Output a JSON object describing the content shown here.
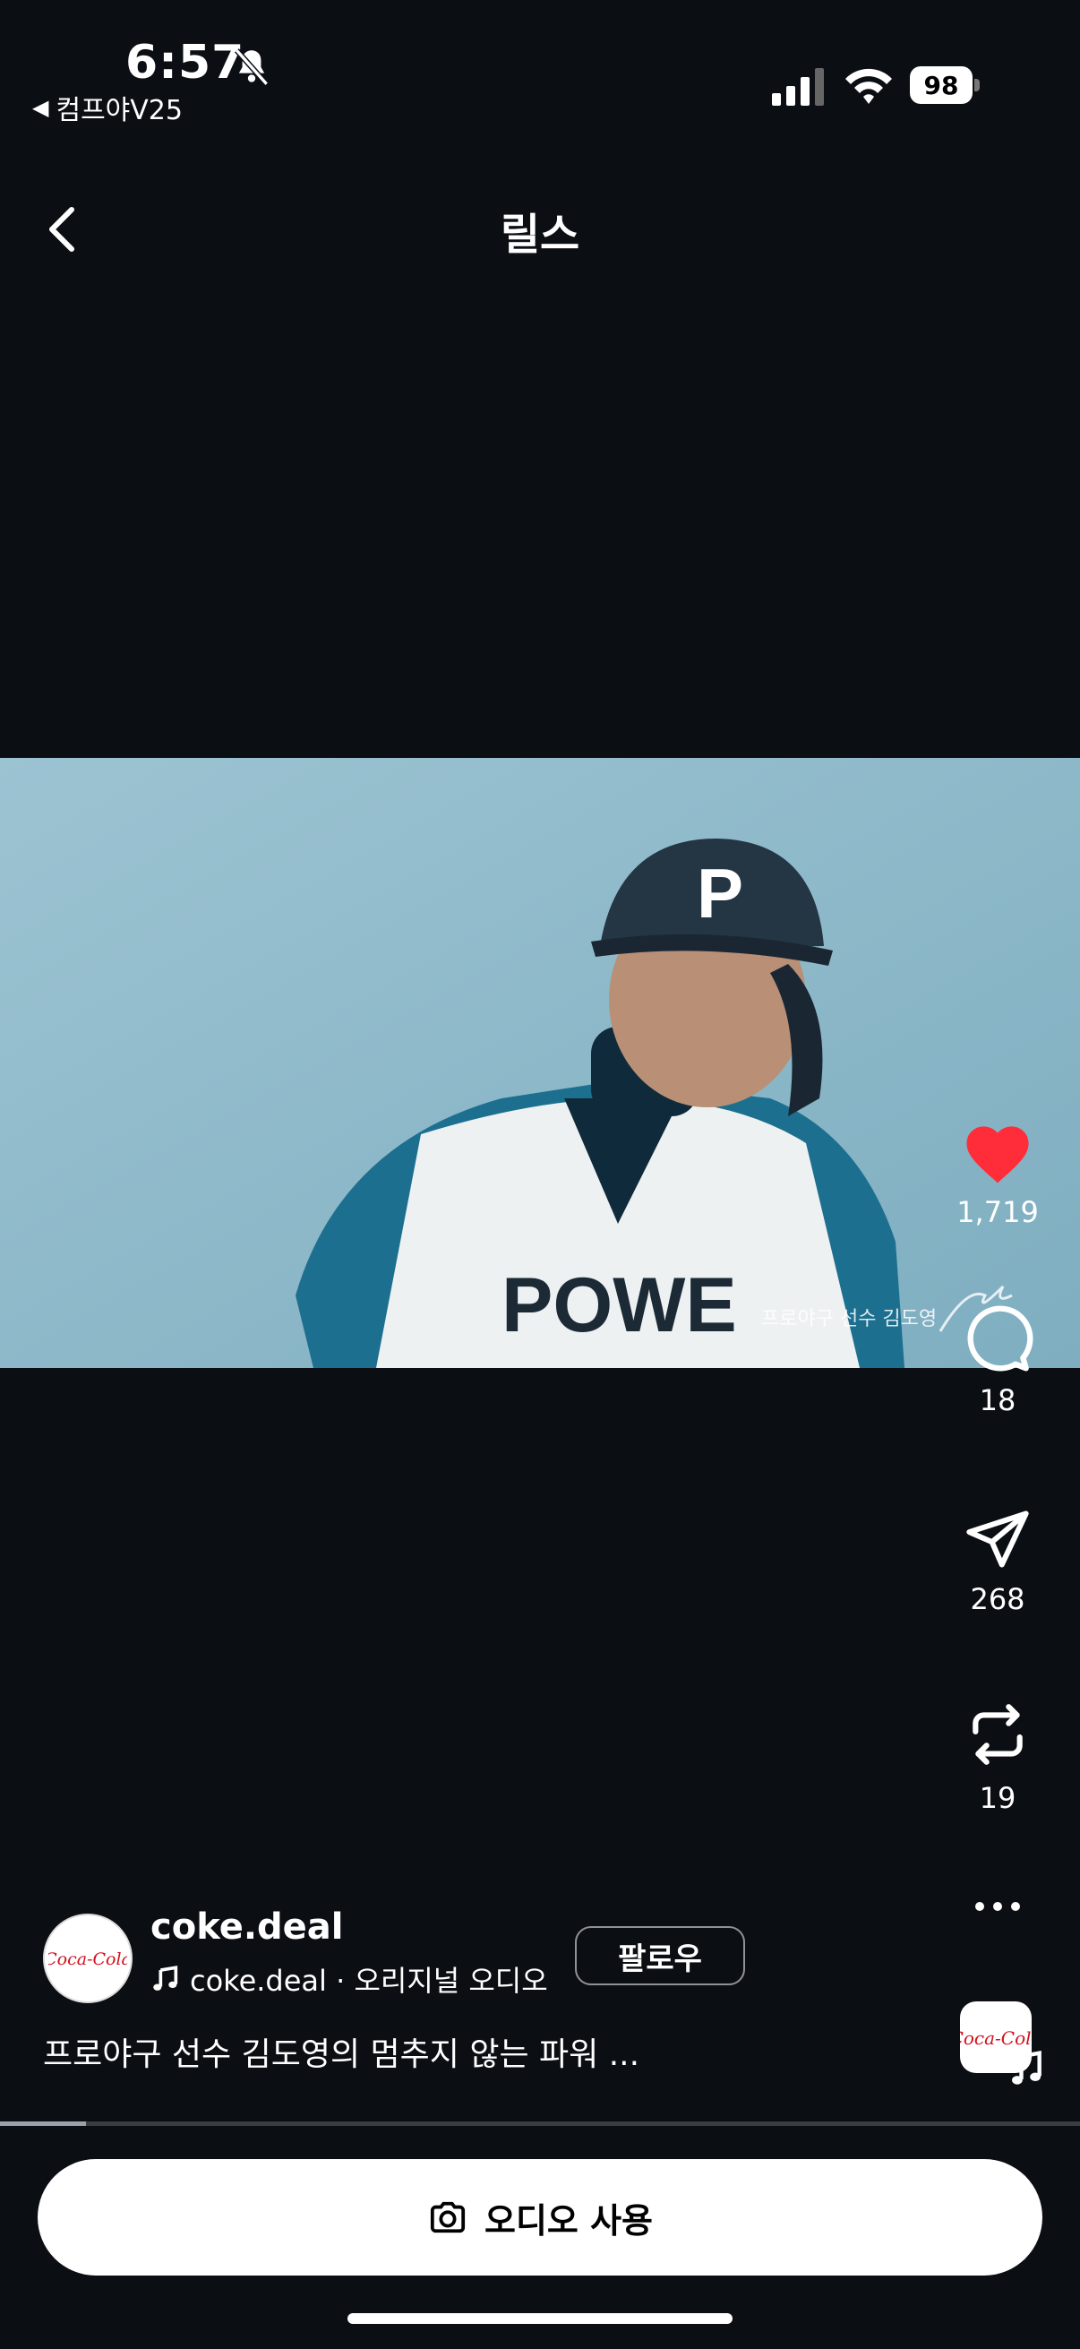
{
  "status": {
    "time": "6:57",
    "back_app": "컴프야V25",
    "battery": "98",
    "icons": [
      "bell-slash-icon",
      "cellular-signal-icon",
      "wifi-icon",
      "battery-icon"
    ]
  },
  "nav": {
    "title": "릴스",
    "back_icon": "chevron-left-icon"
  },
  "video": {
    "overlay_text": "프로야구 선수 김도영"
  },
  "actions": {
    "likes": "1,719",
    "comments": "18",
    "shares": "268",
    "remixes": "19"
  },
  "author": {
    "username": "coke.deal",
    "audio": "coke.deal · 오리지널 오디오",
    "follow_label": "팔로우",
    "caption": "프로야구 선수 김도영의 멈추지 않는 파워 ..."
  },
  "playback": {
    "progress": 0.08
  },
  "bottom": {
    "use_audio_label": "오디오 사용"
  },
  "colors": {
    "background": "#0b0e13",
    "like": "#ff2d3a",
    "sky": "#8eb8c8"
  }
}
